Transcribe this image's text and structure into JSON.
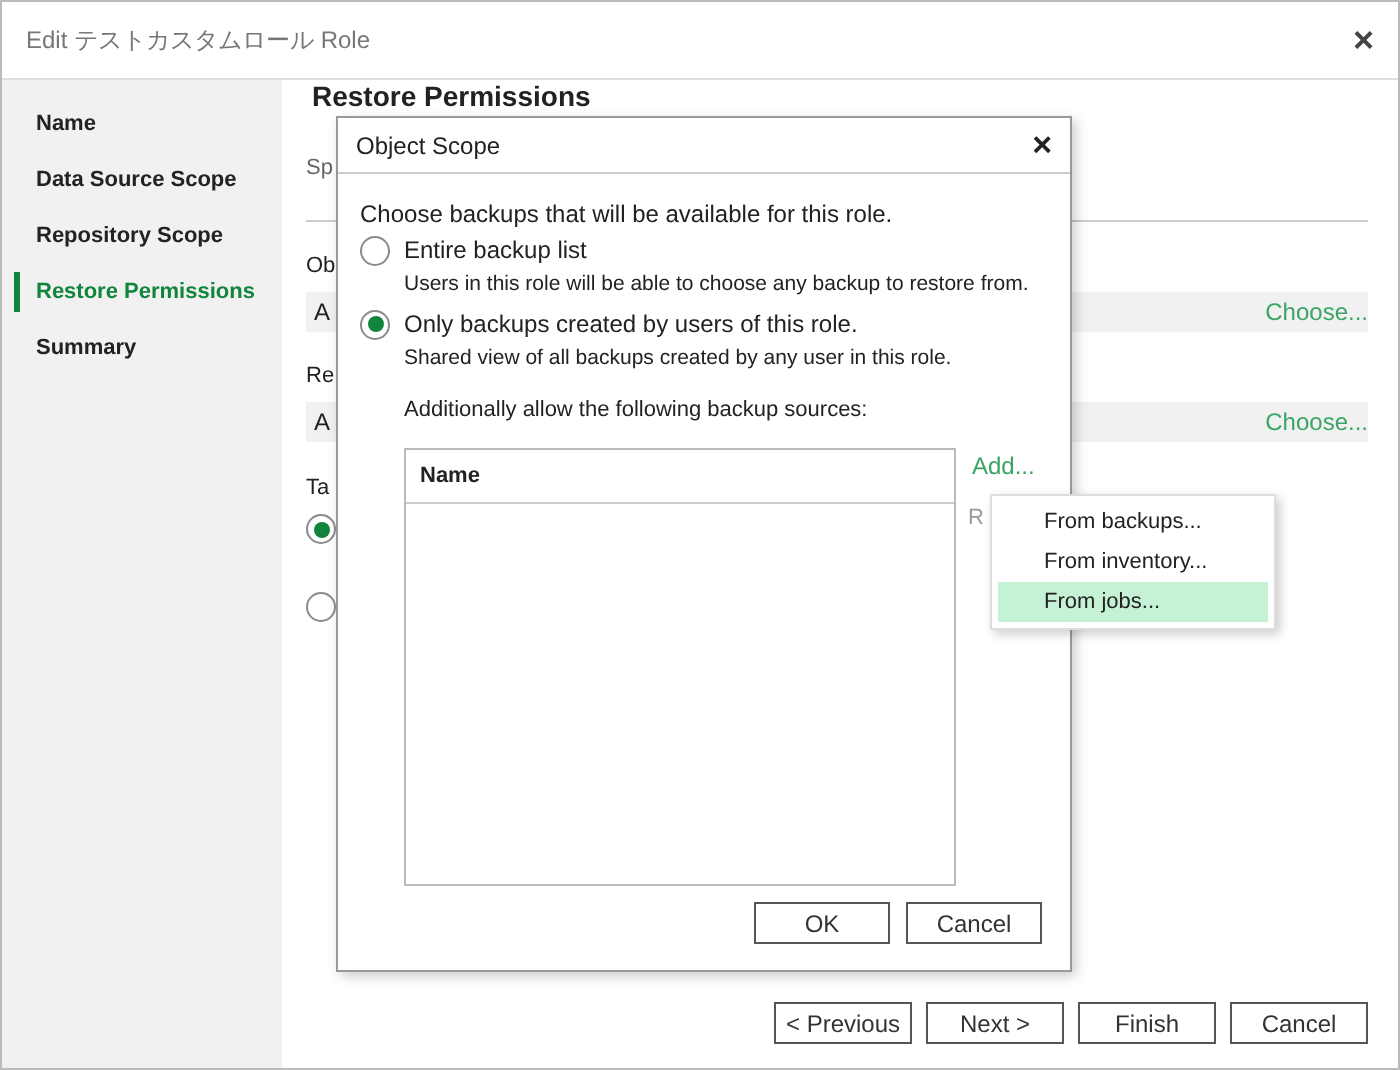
{
  "window": {
    "title": "Edit テストカスタムロール Role",
    "close": "×"
  },
  "sidebar": {
    "items": [
      {
        "label": "Name",
        "selected": false
      },
      {
        "label": "Data Source Scope",
        "selected": false
      },
      {
        "label": "Repository Scope",
        "selected": false
      },
      {
        "label": "Restore Permissions",
        "selected": true
      },
      {
        "label": "Summary",
        "selected": false
      }
    ]
  },
  "page": {
    "heading": "Restore Permissions",
    "subtitle": "Sp",
    "sections": [
      {
        "label": "Ob",
        "value": "A",
        "link": "Choose..."
      },
      {
        "label": "Re",
        "value": "A",
        "link": "Choose..."
      }
    ],
    "target": {
      "label": "Ta",
      "options": [
        {
          "selected": true
        },
        {
          "selected": false
        }
      ]
    }
  },
  "dialog": {
    "title": "Object Scope",
    "close": "×",
    "intro": "Choose backups that will be available for this role.",
    "options": [
      {
        "label": "Entire backup list",
        "description": "Users in this role will be able to choose any backup to restore from.",
        "selected": false
      },
      {
        "label": "Only backups created by users of this role.",
        "description": "Shared view of all backups created by any user in this role.",
        "selected": true
      }
    ],
    "sources_label": "Additionally allow the following backup sources:",
    "table": {
      "columns": [
        "Name"
      ]
    },
    "add_link": "Add...",
    "remove_link": "R",
    "buttons": [
      "OK",
      "Cancel"
    ]
  },
  "menu": {
    "items": [
      {
        "label": "From backups...",
        "selected": false
      },
      {
        "label": "From inventory...",
        "selected": false
      },
      {
        "label": "From jobs...",
        "selected": true
      }
    ]
  },
  "buttons": [
    "< Previous",
    "Next >",
    "Finish",
    "Cancel"
  ]
}
